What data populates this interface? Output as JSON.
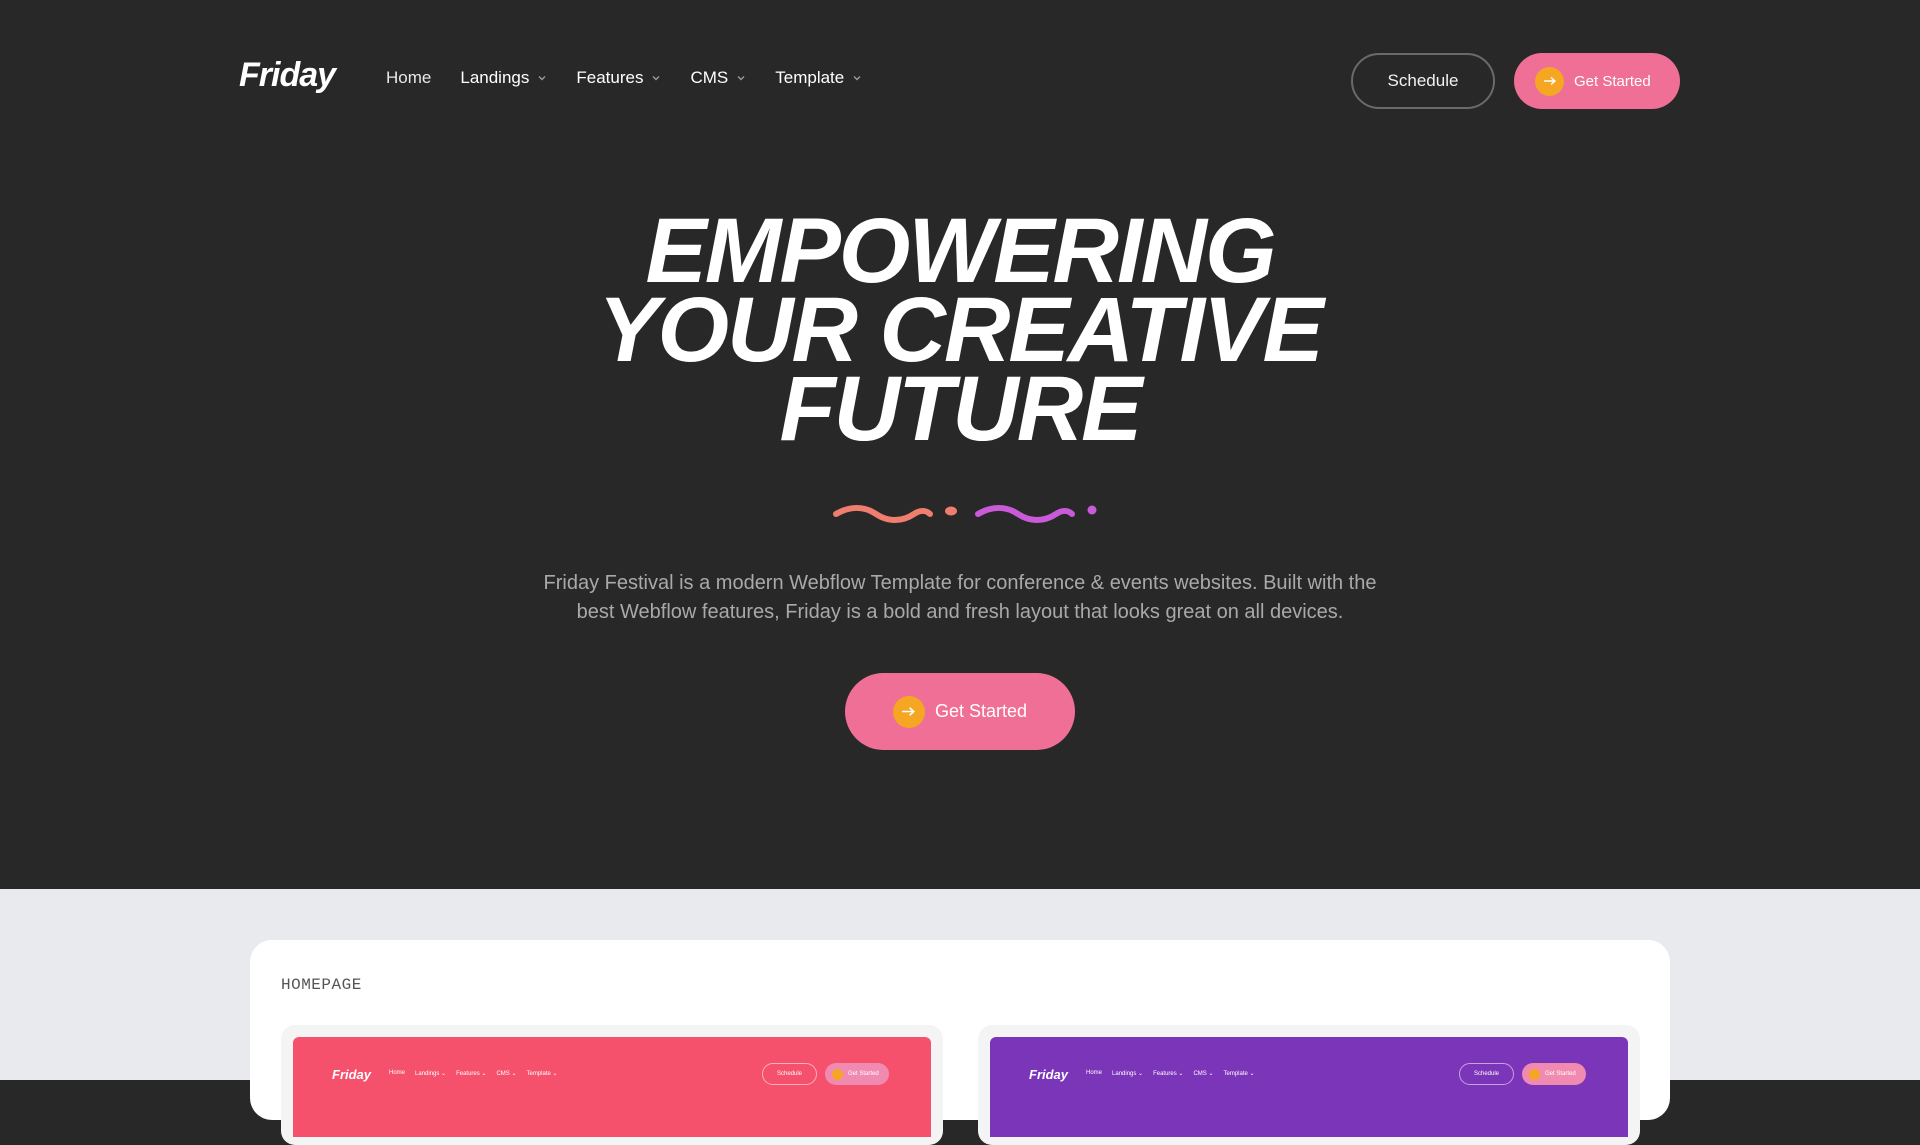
{
  "brand": {
    "logo": "Friday"
  },
  "nav": {
    "items": [
      {
        "label": "Home",
        "has_dropdown": false
      },
      {
        "label": "Landings",
        "has_dropdown": true
      },
      {
        "label": "Features",
        "has_dropdown": true
      },
      {
        "label": "CMS",
        "has_dropdown": true
      },
      {
        "label": "Template",
        "has_dropdown": true
      }
    ],
    "schedule_label": "Schedule",
    "get_started_label": "Get Started"
  },
  "hero": {
    "headline_lines": [
      "EMPOWERING",
      "YOUR CREATIVE",
      "FUTURE"
    ],
    "description": "Friday Festival is a modern Webflow Template for conference & events websites. Built with the best Webflow features, Friday is a bold and fresh layout that looks great on all devices.",
    "cta_label": "Get Started"
  },
  "pages_section": {
    "card_title": "HOMEPAGE",
    "thumbnails": [
      {
        "logo": "Friday",
        "nav": [
          "Home",
          "Landings ⌄",
          "Features ⌄",
          "CMS ⌄",
          "Template ⌄"
        ],
        "schedule": "Schedule",
        "get_started": "Get Started",
        "bg_color": "#f5516d"
      },
      {
        "logo": "Friday",
        "nav": [
          "Home",
          "Landings ⌄",
          "Features ⌄",
          "CMS ⌄",
          "Template ⌄"
        ],
        "schedule": "Schedule",
        "get_started": "Get Started",
        "bg_color": "#7b35b8"
      }
    ]
  },
  "colors": {
    "background": "#282828",
    "accent_pink": "#f06f96",
    "accent_orange": "#f5a623",
    "squiggle_coral": "#f07e6e",
    "squiggle_purple": "#c95ad8",
    "lower_bg": "#e9eaee"
  },
  "icons": [
    "chevron-down-icon",
    "arrow-right-icon",
    "squiggle-decoration"
  ]
}
